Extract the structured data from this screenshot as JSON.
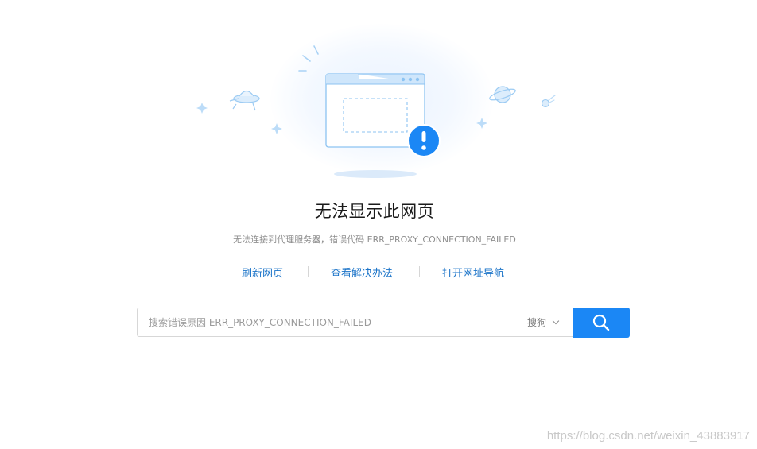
{
  "error": {
    "title": "无法显示此网页",
    "description": "无法连接到代理服务器，错误代码 ERR_PROXY_CONNECTION_FAILED"
  },
  "actions": {
    "refresh_label": "刷新网页",
    "solutions_label": "查看解决办法",
    "navigation_label": "打开网址导航"
  },
  "search": {
    "placeholder": "搜索错误原因 ERR_PROXY_CONNECTION_FAILED",
    "engine": "搜狗"
  },
  "watermark": "https://blog.csdn.net/weixin_43883917",
  "colors": {
    "accent": "#1b87f5",
    "link": "#1a73c8",
    "illustration": "#8cc3f2"
  },
  "icons": {
    "main": "browser-window-error-icon",
    "search": "magnifier-icon"
  }
}
